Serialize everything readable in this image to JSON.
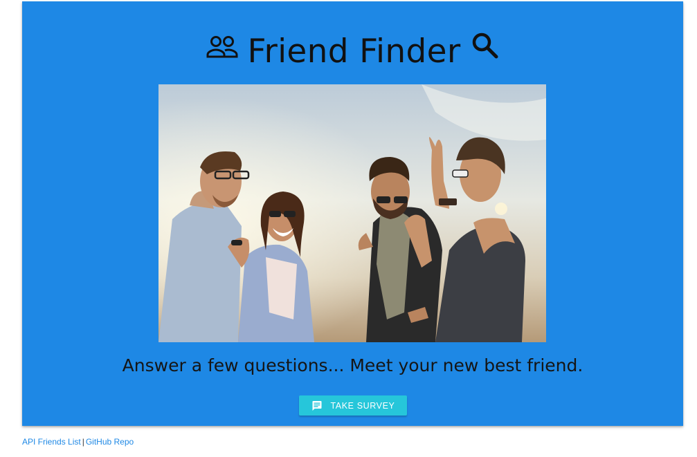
{
  "header": {
    "title": "Friend Finder",
    "left_icon": "people-outline-icon",
    "right_icon": "search-icon"
  },
  "hero": {
    "background_color": "#1e88e5",
    "image": "group of four friends laughing outdoors",
    "tagline": "Answer a few questions... Meet your new best friend."
  },
  "survey_button": {
    "icon": "chat-icon",
    "label": "TAKE SURVEY",
    "color": "#26c6da"
  },
  "footer": {
    "api_link": "API Friends List",
    "separator": "|",
    "repo_link": "GitHub Repo",
    "link_color": "#1e88e5"
  }
}
